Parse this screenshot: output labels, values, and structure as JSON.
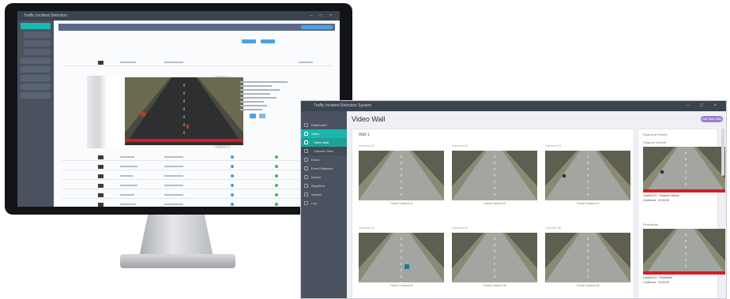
{
  "monitor": {
    "title": "Traffic Incident Detection",
    "window_controls": "– □ ×",
    "rows": 6
  },
  "window": {
    "title": "Traffic Incident Detection System",
    "window_controls": "– □ ×",
    "page_title": "Video Wall",
    "add_button": "Add Video Wall",
    "panel_title": "Wall 1",
    "sidebar": [
      {
        "label": "Dashboard",
        "icon": "dashboard-icon"
      },
      {
        "label": "Video",
        "icon": "video-icon",
        "active": true
      },
      {
        "label": "Video Wall",
        "icon": "grid-icon",
        "sub": true,
        "active": true
      },
      {
        "label": "Camera Video",
        "icon": "camera-icon",
        "sub": true
      },
      {
        "label": "Event",
        "icon": "alert-icon"
      },
      {
        "label": "Event Statistics",
        "icon": "chart-icon"
      },
      {
        "label": "Device",
        "icon": "device-icon"
      },
      {
        "label": "Algorithm",
        "icon": "algorithm-icon"
      },
      {
        "label": "System",
        "icon": "gear-icon"
      },
      {
        "label": "Log",
        "icon": "log-icon"
      }
    ],
    "cameras": [
      {
        "label": "Camera 01",
        "caption": "Tunnel Camera 01"
      },
      {
        "label": "Camera 02",
        "caption": "Tunnel Camera 02"
      },
      {
        "label": "Camera 03",
        "caption": "Tunnel Camera 03"
      },
      {
        "label": "Camera 04",
        "caption": "Tunnel Camera 04"
      },
      {
        "label": "Camera 05",
        "caption": "Tunnel Camera 05"
      },
      {
        "label": "Camera 06",
        "caption": "Tunnel Camera 06"
      }
    ],
    "events_title": "Real-time Events",
    "events": [
      {
        "title": "Stopped Vehicle",
        "text": "Camera 01 · Stopped Vehicle",
        "sub": "Confirmed · 00:00:00"
      },
      {
        "title": "Pedestrian",
        "text": "Camera 04 · Pedestrian",
        "sub": "Confirmed · 00:00:00"
      }
    ],
    "colors": {
      "accent": "#1ab5ad",
      "alert": "#d81b25",
      "button": "#9b7fd1",
      "sidebar": "#4b5360"
    }
  }
}
